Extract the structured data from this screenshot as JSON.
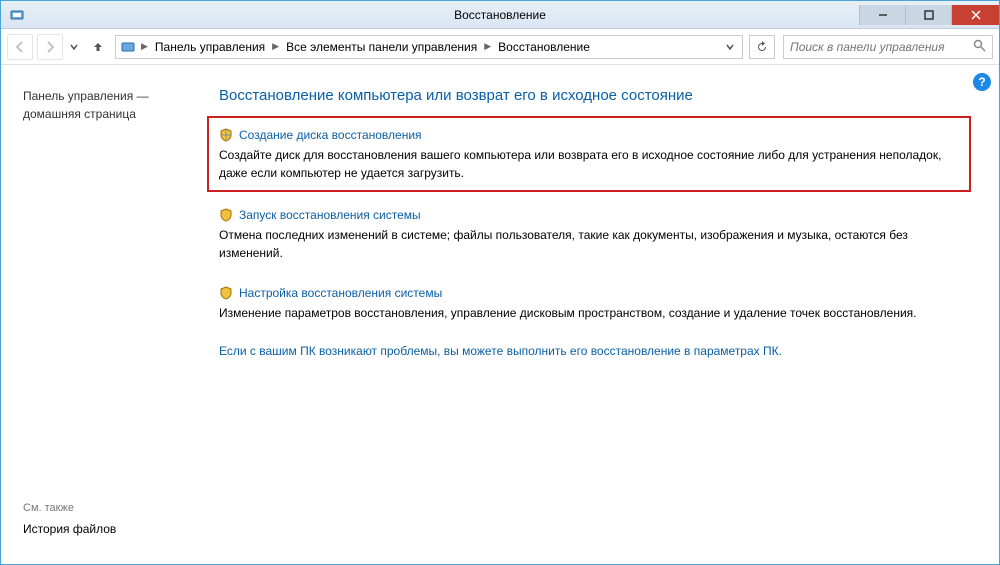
{
  "window": {
    "title": "Восстановление"
  },
  "breadcrumb": {
    "seg1": "Панель управления",
    "seg2": "Все элементы панели управления",
    "seg3": "Восстановление"
  },
  "search": {
    "placeholder": "Поиск в панели управления"
  },
  "sidebar": {
    "home_line1": "Панель управления —",
    "home_line2": "домашняя страница",
    "seealso": "См. также",
    "history": "История файлов"
  },
  "main": {
    "heading": "Восстановление компьютера или возврат его в исходное состояние",
    "opt1": {
      "title": "Создание диска восстановления",
      "desc": "Создайте диск для восстановления вашего компьютера или возврата его в исходное состояние либо для устранения неполадок, даже если компьютер не удается загрузить."
    },
    "opt2": {
      "title": "Запуск восстановления системы",
      "desc": "Отмена последних изменений в системе; файлы пользователя, такие как документы, изображения и музыка, остаются без изменений."
    },
    "opt3": {
      "title": "Настройка восстановления системы",
      "desc": "Изменение параметров восстановления, управление дисковым пространством, создание и удаление точек восстановления."
    },
    "bottomlink": "Если с вашим ПК возникают проблемы, вы можете выполнить его восстановление в параметрах ПК."
  }
}
